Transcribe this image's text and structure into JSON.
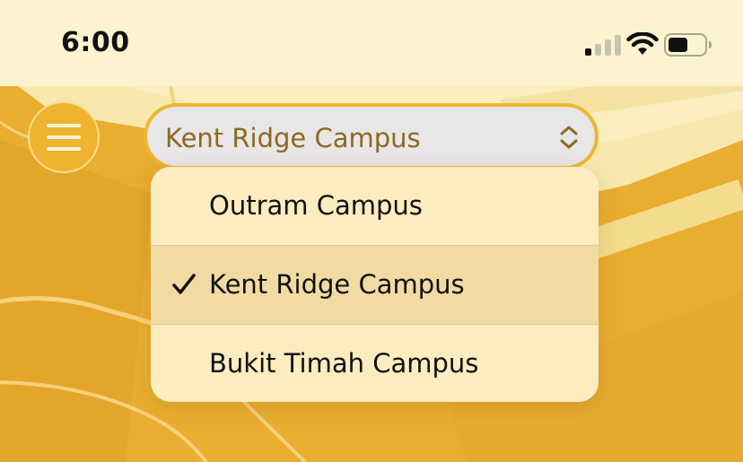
{
  "status_bar": {
    "time": "6:00",
    "icons": [
      "cellular-signal-icon",
      "wifi-icon",
      "battery-icon"
    ]
  },
  "header": {
    "menu_icon": "hamburger-menu-icon",
    "campus_picker": {
      "selected_value": "Kent Ridge Campus",
      "icon": "chevron-up-down-icon"
    }
  },
  "dropdown": {
    "options": [
      {
        "label": "Outram Campus",
        "selected": false
      },
      {
        "label": "Kent Ridge Campus",
        "selected": true
      },
      {
        "label": "Bukit Timah Campus",
        "selected": false
      }
    ],
    "selected_icon": "checkmark-icon"
  },
  "colors": {
    "status_bar_bg": "#fdf4cf",
    "map_primary": "#e9ad2f",
    "map_roads": "#f2d070",
    "accent": "#ecb632",
    "picker_text": "#8a6a1f",
    "dropdown_bg": "#fcecbf",
    "dropdown_selected_bg": "#f2dba3"
  }
}
